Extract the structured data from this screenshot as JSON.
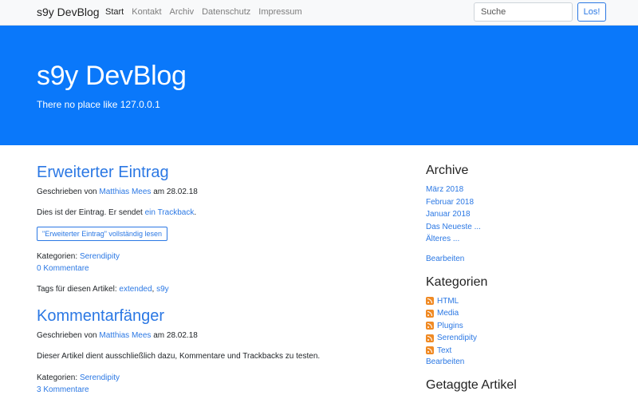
{
  "navbar": {
    "brand": "s9y DevBlog",
    "items": [
      {
        "label": "Start",
        "active": true
      },
      {
        "label": "Kontakt"
      },
      {
        "label": "Archiv"
      },
      {
        "label": "Datenschutz"
      },
      {
        "label": "Impressum"
      }
    ],
    "search_placeholder": "Suche",
    "search_button": "Los!"
  },
  "hero": {
    "title": "s9y DevBlog",
    "subtitle": "There no place like 127.0.0.1"
  },
  "posts": [
    {
      "title": "Erweiterter Eintrag",
      "meta_prefix": "Geschrieben von",
      "author": "Matthias Mees",
      "meta_mid": "am",
      "date": "28.02.18",
      "body_prefix": "Dies ist der Eintrag. Er sendet",
      "body_link": "ein Trackback",
      "body_suffix": ".",
      "readmore": "\"Erweiterter Eintrag\" vollständig lesen",
      "categories_label": "Kategorien:",
      "category": "Serendipity",
      "comments": "0 Kommentare",
      "tags_label": "Tags für diesen Artikel:",
      "tag1": "extended",
      "tag_sep": ",",
      "tag2": "s9y"
    },
    {
      "title": "Kommentarfänger",
      "meta_prefix": "Geschrieben von",
      "author": "Matthias Mees",
      "meta_mid": "am",
      "date": "28.02.18",
      "body": "Dieser Artikel dient ausschließlich dazu, Kommentare und Trackbacks zu testen.",
      "categories_label": "Kategorien:",
      "category": "Serendipity",
      "comments": "3 Kommentare"
    }
  ],
  "sidebar": {
    "archive": {
      "title": "Archive",
      "items": [
        "März 2018",
        "Februar 2018",
        "Januar 2018",
        "Das Neueste ...",
        "Älteres ..."
      ],
      "edit": "Bearbeiten"
    },
    "categories": {
      "title": "Kategorien",
      "items": [
        "HTML",
        "Media",
        "Plugins",
        "Serendipity",
        "Text"
      ],
      "icon": "rss-icon",
      "icon_color": "#f08a24",
      "edit": "Bearbeiten"
    },
    "tagged": {
      "title": "Getaggte Artikel"
    }
  },
  "colors": {
    "accent": "#2b78e4",
    "hero": "#0a78fa"
  }
}
